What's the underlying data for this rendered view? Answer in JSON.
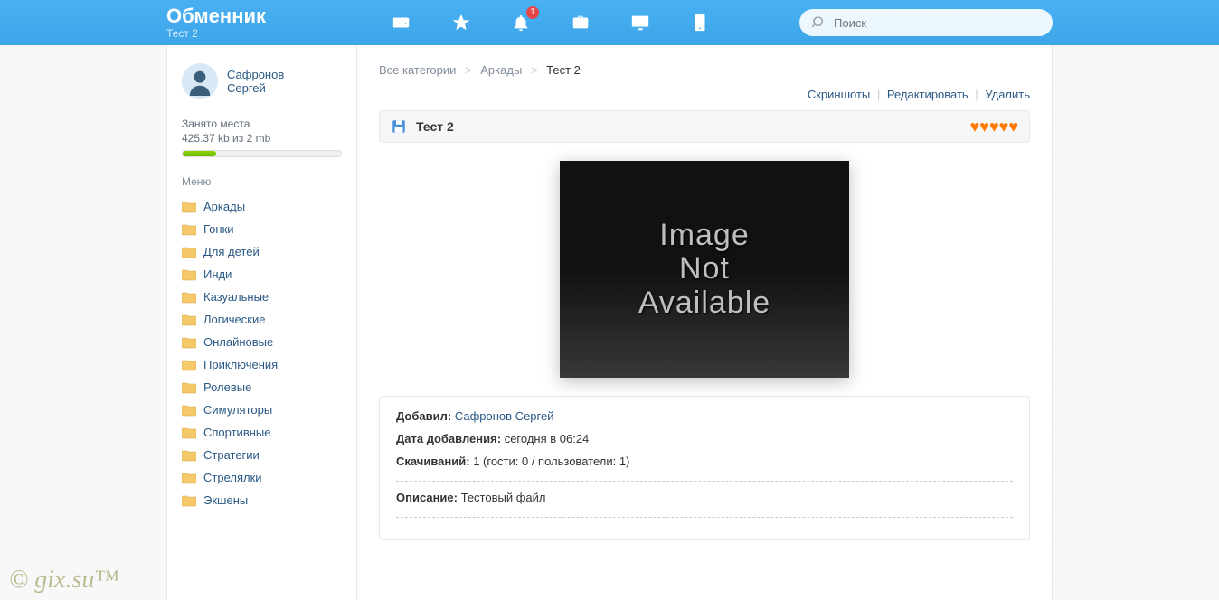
{
  "header": {
    "site_title": "Обменник",
    "site_subtitle": "Тест 2",
    "notification_count": "1",
    "search_placeholder": "Поиск"
  },
  "user": {
    "name_line1": "Сафронов",
    "name_line2": "Сергей"
  },
  "storage": {
    "label": "Занято места",
    "value": "425.37 kb из 2 mb"
  },
  "menu": {
    "title": "Меню",
    "items": [
      "Аркады",
      "Гонки",
      "Для детей",
      "Инди",
      "Казуальные",
      "Логические",
      "Онлайновые",
      "Приключения",
      "Ролевые",
      "Симуляторы",
      "Спортивные",
      "Стратегии",
      "Стрелялки",
      "Экшены"
    ]
  },
  "breadcrumb": {
    "all": "Все категории",
    "cat": "Аркады",
    "current": "Тест 2"
  },
  "actions": {
    "screenshots": "Скриншоты",
    "edit": "Редактировать",
    "delete": "Удалить"
  },
  "item": {
    "title": "Тест 2",
    "image_placeholder": "Image\nNot\nAvailable"
  },
  "info": {
    "added_by_label": "Добавил:",
    "added_by_value": "Сафронов Сергей",
    "date_label": "Дата добавления:",
    "date_value": "сегодня в 06:24",
    "downloads_label": "Скачиваний:",
    "downloads_value": "1 (гости: 0 / пользователи: 1)",
    "desc_label": "Описание:",
    "desc_value": "Тестовый файл"
  },
  "watermark": "© gix.su™"
}
